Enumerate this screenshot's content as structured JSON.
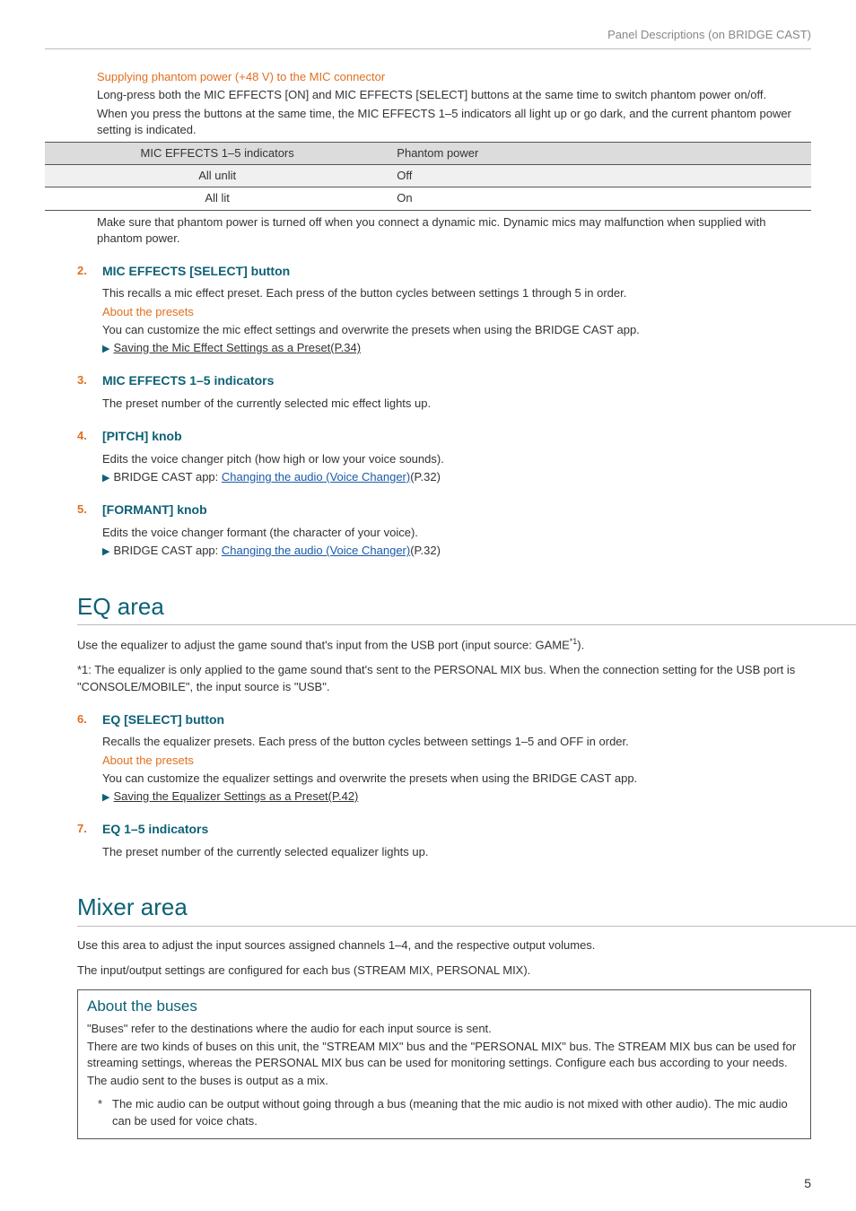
{
  "header": {
    "breadcrumb": "Panel Descriptions (on BRIDGE CAST)"
  },
  "phantom": {
    "heading": "Supplying phantom power (+48 V) to the MIC connector",
    "p1": "Long-press both the MIC EFFECTS [ON] and MIC EFFECTS [SELECT] buttons at the same time to switch phantom power on/off.",
    "p2": "When you press the buttons at the same time, the MIC EFFECTS 1–5 indicators all light up or go dark, and the current phantom power setting is indicated.",
    "th1": "MIC EFFECTS 1–5 indicators",
    "th2": "Phantom power",
    "r1c1": "All unlit",
    "r1c2": "Off",
    "r2c1": "All lit",
    "r2c2": "On",
    "note": "Make sure that phantom power is turned off when you connect a dynamic mic. Dynamic mics may malfunction when supplied with phantom power."
  },
  "items": {
    "i2": {
      "num": "2.",
      "title": "MIC EFFECTS [SELECT] button",
      "p1": "This recalls a mic effect preset. Each press of the button cycles between settings 1 through 5 in order.",
      "about": "About the presets",
      "p2": "You can customize the mic effect settings and overwrite the presets when using the BRIDGE CAST app.",
      "link": "Saving the Mic Effect Settings as a Preset(P.34)"
    },
    "i3": {
      "num": "3.",
      "title": "MIC EFFECTS 1–5 indicators",
      "p1": "The preset number of the currently selected mic effect lights up."
    },
    "i4": {
      "num": "4.",
      "title": "[PITCH] knob",
      "p1": "Edits the voice changer pitch (how high or low your voice sounds).",
      "pre": "BRIDGE CAST app: ",
      "link": "Changing the audio (Voice Changer)",
      "post": "(P.32)"
    },
    "i5": {
      "num": "5.",
      "title": "[FORMANT] knob",
      "p1": "Edits the voice changer formant (the character of your voice).",
      "pre": "BRIDGE CAST app: ",
      "link": "Changing the audio (Voice Changer)",
      "post": "(P.32)"
    },
    "i6": {
      "num": "6.",
      "title": "EQ [SELECT] button",
      "p1": "Recalls the equalizer presets. Each press of the button cycles between settings 1–5 and OFF in order.",
      "about": "About the presets",
      "p2": "You can customize the equalizer settings and overwrite the presets when using the BRIDGE CAST app.",
      "link": "Saving the Equalizer Settings as a Preset(P.42)"
    },
    "i7": {
      "num": "7.",
      "title": "EQ 1–5 indicators",
      "p1": "The preset number of the currently selected equalizer lights up."
    }
  },
  "eq": {
    "heading": "EQ area",
    "p1a": "Use the equalizer to adjust the game sound that's input from the USB port (input source: GAME",
    "p1sup": "*1",
    "p1b": ").",
    "p2": "*1: The equalizer is only applied to the game sound that's sent to the PERSONAL MIX bus. When the connection setting for the USB port is \"CONSOLE/MOBILE\", the input source is \"USB\"."
  },
  "mixer": {
    "heading": "Mixer area",
    "p1": "Use this area to adjust the input sources assigned channels 1–4, and the respective output volumes.",
    "p2": "The input/output settings are configured for each bus (STREAM MIX, PERSONAL MIX)."
  },
  "buses": {
    "heading": "About the buses",
    "p1": "\"Buses\" refer to the destinations where the audio for each input source is sent.",
    "p2": "There are two kinds of buses on this unit, the \"STREAM MIX\" bus and the \"PERSONAL MIX\" bus. The STREAM MIX bus can be used for streaming settings, whereas the PERSONAL MIX bus can be used for monitoring settings. Configure each bus according to your needs.",
    "p3": "The audio sent to the buses is output as a mix.",
    "ast": "*",
    "note": "The mic audio can be output without going through a bus (meaning that the mic audio is not mixed with other audio). The mic audio can be used for voice chats."
  },
  "page": "5"
}
